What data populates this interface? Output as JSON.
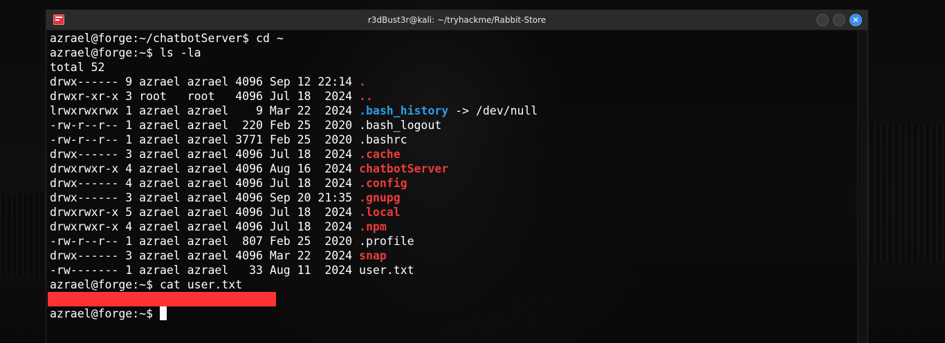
{
  "window": {
    "title": "r3dBust3r@kali: ~/tryhackme/Rabbit-Store",
    "close_glyph": "✕"
  },
  "terminal": {
    "prompt_user": "azrael@forge",
    "lines": [
      {
        "prompt": "azrael@forge:~/chatbotServer$ ",
        "cmd": "cd ~"
      },
      {
        "prompt": "azrael@forge:~$ ",
        "cmd": "ls -la"
      },
      {
        "text": "total 52"
      }
    ],
    "listing": [
      {
        "meta": "drwx------ 9 azrael azrael 4096 Sep 12 22:14 ",
        "name": ".",
        "style": "red"
      },
      {
        "meta": "drwxr-xr-x 3 root   root   4096 Jul 18  2024 ",
        "name": "..",
        "style": "red"
      },
      {
        "meta": "lrwxrwxrwx 1 azrael azrael    9 Mar 22  2024 ",
        "name": ".bash_history",
        "style": "blue",
        "suffix": " -> /dev/null"
      },
      {
        "meta": "-rw-r--r-- 1 azrael azrael  220 Feb 25  2020 ",
        "name": ".bash_logout",
        "style": "plain"
      },
      {
        "meta": "-rw-r--r-- 1 azrael azrael 3771 Feb 25  2020 ",
        "name": ".bashrc",
        "style": "plain"
      },
      {
        "meta": "drwx------ 3 azrael azrael 4096 Jul 18  2024 ",
        "name": ".cache",
        "style": "red"
      },
      {
        "meta": "drwxrwxr-x 4 azrael azrael 4096 Aug 16  2024 ",
        "name": "chatbotServer",
        "style": "red"
      },
      {
        "meta": "drwx------ 4 azrael azrael 4096 Jul 18  2024 ",
        "name": ".config",
        "style": "red"
      },
      {
        "meta": "drwx------ 3 azrael azrael 4096 Sep 20 21:35 ",
        "name": ".gnupg",
        "style": "red"
      },
      {
        "meta": "drwxrwxr-x 5 azrael azrael 4096 Jul 18  2024 ",
        "name": ".local",
        "style": "red"
      },
      {
        "meta": "drwxrwxr-x 4 azrael azrael 4096 Jul 18  2024 ",
        "name": ".npm",
        "style": "red"
      },
      {
        "meta": "-rw-r--r-- 1 azrael azrael  807 Feb 25  2020 ",
        "name": ".profile",
        "style": "plain"
      },
      {
        "meta": "drwx------ 3 azrael azrael 4096 Mar 22  2024 ",
        "name": "snap",
        "style": "red"
      },
      {
        "meta": "-rw------- 1 azrael azrael   33 Aug 11  2024 ",
        "name": "user.txt",
        "style": "plain"
      }
    ],
    "after": [
      {
        "prompt": "azrael@forge:~$ ",
        "cmd": "cat user.txt"
      }
    ],
    "final_prompt": "azrael@forge:~$ ",
    "colors": {
      "dir": "#ef3b3b",
      "link": "#2f9be8",
      "redaction": "#ff3333",
      "close_button": "#3b8ee6"
    }
  }
}
